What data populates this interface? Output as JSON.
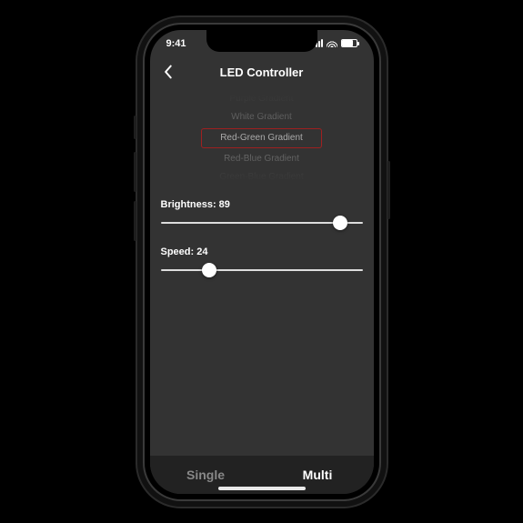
{
  "status": {
    "time": "9:41"
  },
  "nav": {
    "title": "LED Controller"
  },
  "picker": {
    "items": [
      "Purple Gradient",
      "White Gradient",
      "Red-Green Gradient",
      "Red-Blue Gradient",
      "Green-Blue Gradient"
    ],
    "selectedIndex": 2
  },
  "sliders": {
    "brightness": {
      "label": "Brightness: 89",
      "value": 89,
      "min": 0,
      "max": 100
    },
    "speed": {
      "label": "Speed: 24",
      "value": 24,
      "min": 0,
      "max": 100
    }
  },
  "tabs": {
    "single": "Single",
    "multi": "Multi",
    "active": "multi"
  }
}
